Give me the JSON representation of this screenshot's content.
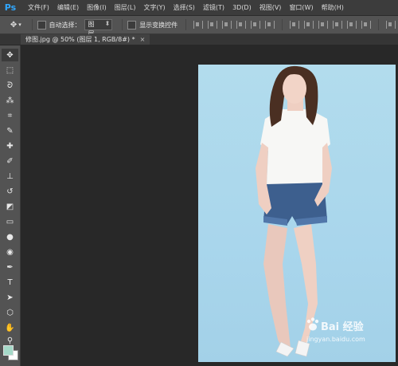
{
  "app": {
    "logo": "Ps"
  },
  "menu": [
    "文件(F)",
    "编辑(E)",
    "图像(I)",
    "图层(L)",
    "文字(Y)",
    "选择(S)",
    "滤镜(T)",
    "3D(D)",
    "视图(V)",
    "窗口(W)",
    "帮助(H)"
  ],
  "options": {
    "auto_select_label": "自动选择：",
    "auto_select_value": "图层",
    "show_transform_label": "显示变换控件"
  },
  "document_tab": {
    "title": "修图.jpg @ 50% (图层 1, RGB/8#) *",
    "close": "×"
  },
  "watermark": {
    "brand": "Bai 经验",
    "url": "jingyan.baidu.com"
  },
  "colors": {
    "foreground": "#a5d9c8",
    "background": "#ffffff"
  },
  "tools": [
    "move-icon",
    "marquee-icon",
    "lasso-icon",
    "magic-wand-icon",
    "crop-icon",
    "eyedropper-icon",
    "healing-brush-icon",
    "brush-icon",
    "clone-stamp-icon",
    "history-brush-icon",
    "eraser-icon",
    "gradient-icon",
    "blur-icon",
    "dodge-icon",
    "pen-icon",
    "type-icon",
    "path-select-icon",
    "shape-icon",
    "hand-icon",
    "zoom-icon"
  ]
}
